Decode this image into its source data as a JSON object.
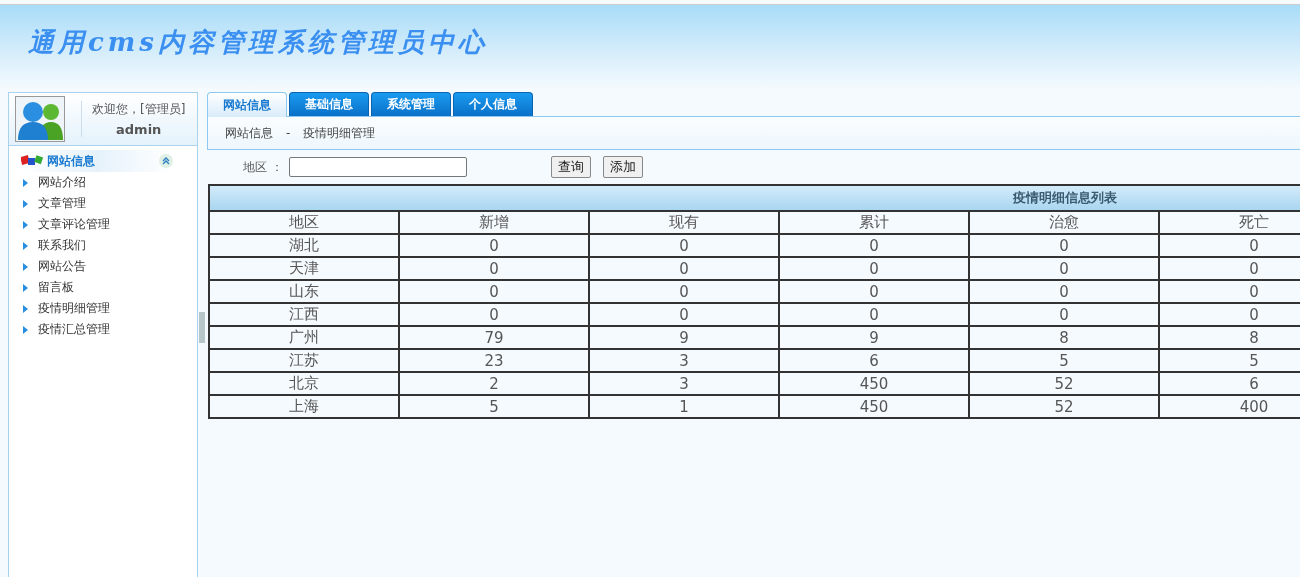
{
  "header": {
    "title": "通用cms内容管理系统管理员中心"
  },
  "user": {
    "greeting": "欢迎您，[管理员]",
    "name": "admin"
  },
  "sidebar": {
    "section": {
      "label": "网站信息",
      "expanded": true
    },
    "items": [
      {
        "label": "网站介绍"
      },
      {
        "label": "文章管理"
      },
      {
        "label": "文章评论管理"
      },
      {
        "label": "联系我们"
      },
      {
        "label": "网站公告"
      },
      {
        "label": "留言板"
      },
      {
        "label": "疫情明细管理"
      },
      {
        "label": "疫情汇总管理"
      }
    ]
  },
  "tabs": [
    {
      "label": "网站信息",
      "selected": true
    },
    {
      "label": "基础信息",
      "selected": false
    },
    {
      "label": "系统管理",
      "selected": false
    },
    {
      "label": "个人信息",
      "selected": false
    }
  ],
  "breadcrumb": [
    "网站信息",
    "-",
    "疫情明细管理"
  ],
  "search": {
    "label": "地区 ：",
    "query_button": "查询",
    "add_button": "添加"
  },
  "table": {
    "title": "疫情明细信息列表",
    "columns": [
      "地区",
      "新增",
      "现有",
      "累计",
      "治愈",
      "死亡"
    ],
    "rows": [
      [
        "湖北",
        "0",
        "0",
        "0",
        "0",
        "0"
      ],
      [
        "天津",
        "0",
        "0",
        "0",
        "0",
        "0"
      ],
      [
        "山东",
        "0",
        "0",
        "0",
        "0",
        "0"
      ],
      [
        "江西",
        "0",
        "0",
        "0",
        "0",
        "0"
      ],
      [
        "广州",
        "79",
        "9",
        "9",
        "8",
        "8"
      ],
      [
        "江苏",
        "23",
        "3",
        "6",
        "5",
        "5"
      ],
      [
        "北京",
        "2",
        "3",
        "450",
        "52",
        "6"
      ],
      [
        "上海",
        "5",
        "1",
        "450",
        "52",
        "400"
      ]
    ]
  }
}
